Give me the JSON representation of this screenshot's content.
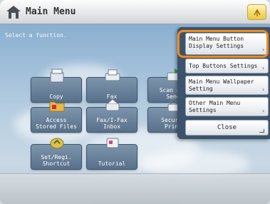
{
  "header": {
    "title": "Main Menu"
  },
  "main": {
    "prompt": "Select a function.",
    "tiles": [
      {
        "label": "Copy",
        "icon": "copier-icon"
      },
      {
        "label": "Fax",
        "icon": "fax-icon"
      },
      {
        "label": "Scan and\nSend",
        "icon": "scanner-icon"
      },
      {
        "label": "Access\nStored Files",
        "icon": "folder-icon"
      },
      {
        "label": "Fax/I-Fax\nInbox",
        "icon": "inbox-icon"
      },
      {
        "label": "Secured\nPrint",
        "icon": "lock-icon"
      },
      {
        "label": "Set/Regi.\nShortcut",
        "icon": "shortcut-icon"
      },
      {
        "label": "Tutorial",
        "icon": "tutorial-icon"
      }
    ]
  },
  "panel": {
    "items": [
      {
        "label": "Main Menu Button\nDisplay Settings"
      },
      {
        "label": "Top Buttons Settings"
      },
      {
        "label": "Main Menu Wallpaper\nSetting"
      },
      {
        "label": "Other Main Menu\nSettings"
      }
    ],
    "close_label": "Close"
  },
  "colors": {
    "highlight": "#f08a1a",
    "panel": "#3d536d",
    "tile": "#58708a"
  }
}
